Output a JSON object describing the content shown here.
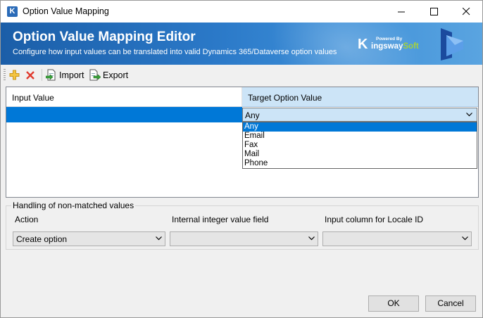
{
  "window": {
    "title": "Option Value Mapping",
    "app_icon_letter": "K"
  },
  "banner": {
    "title": "Option Value Mapping Editor",
    "subtitle": "Configure how input values can be translated into valid Dynamics 365/Dataverse option values",
    "logo_powered": "Powered By",
    "logo_name_main": "ingsway",
    "logo_name_accent": "Soft",
    "logo_k": "K"
  },
  "toolbar": {
    "add_icon": "plus-icon",
    "delete_icon": "x-delete-icon",
    "import_label": "Import",
    "export_label": "Export"
  },
  "grid": {
    "columns": [
      "Input Value",
      "Target Option Value"
    ],
    "rows": [
      {
        "input_value": "",
        "target_value": "Any"
      }
    ]
  },
  "dropdown": {
    "options": [
      "Any",
      "Email",
      "Fax",
      "Mail",
      "Phone"
    ],
    "selected": "Any"
  },
  "non_matched": {
    "legend": "Handling of non-matched values",
    "action_label": "Action",
    "action_value": "Create option",
    "integer_field_label": "Internal integer value field",
    "integer_field_value": "",
    "locale_label": "Input column for Locale ID",
    "locale_value": ""
  },
  "buttons": {
    "ok": "OK",
    "cancel": "Cancel"
  },
  "colors": {
    "accent": "#0078d7",
    "header_selected": "#cce4f7",
    "banner": "#1b5ea8",
    "logo_accent": "#a6d23a"
  }
}
